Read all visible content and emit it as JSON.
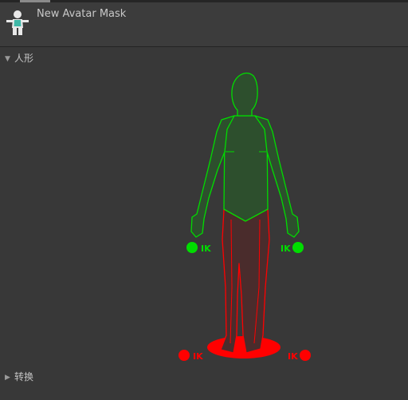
{
  "header": {
    "title": "New Avatar Mask",
    "icon": "avatar-mask-icon"
  },
  "sections": {
    "humanoid": {
      "label": "人形",
      "expanded": true,
      "arrow_icon": "triangle-down-icon"
    },
    "transform": {
      "label": "转换",
      "expanded": false,
      "arrow_icon": "triangle-right-icon"
    }
  },
  "humanoid_mask": {
    "ik_label": "IK",
    "parts": [
      {
        "name": "head",
        "enabled": true
      },
      {
        "name": "body",
        "enabled": true
      },
      {
        "name": "left-arm",
        "enabled": true
      },
      {
        "name": "right-arm",
        "enabled": true
      },
      {
        "name": "left-hand-ik",
        "enabled": true
      },
      {
        "name": "right-hand-ik",
        "enabled": true
      },
      {
        "name": "legs",
        "enabled": false
      },
      {
        "name": "root",
        "enabled": false
      },
      {
        "name": "left-foot-ik",
        "enabled": false
      },
      {
        "name": "right-foot-ik",
        "enabled": false
      }
    ],
    "colors": {
      "enabled": "#00dd00",
      "enabled_fill": "#2d4f2d",
      "disabled": "#ff0000",
      "disabled_fill": "#4a2c2c"
    }
  }
}
